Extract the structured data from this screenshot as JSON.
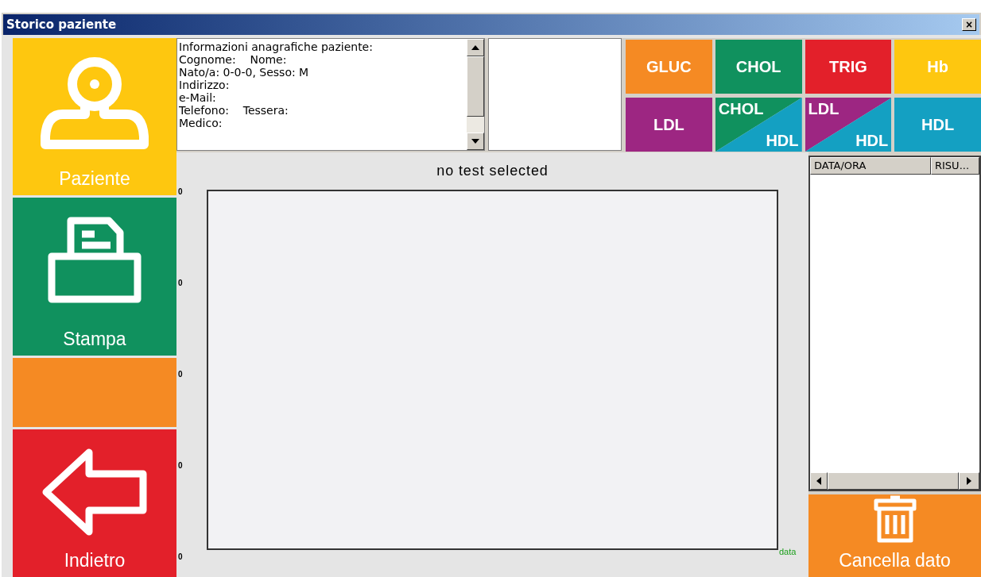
{
  "window": {
    "title": "Storico paziente",
    "close": "×"
  },
  "side_buttons": [
    {
      "kind": "patient",
      "label": "Paziente",
      "color": "#fec70f"
    },
    {
      "kind": "print",
      "label": "Stampa",
      "color": "#10915e"
    },
    {
      "kind": "blank",
      "color": "#f58a23"
    },
    {
      "kind": "back",
      "label": "Indietro",
      "color": "#e3202a"
    }
  ],
  "patient_info": [
    "Informazioni anagrafiche paziente:",
    "Cognome:    Nome:",
    "Nato/a: 0-0-0, Sesso: M",
    "Indirizzo:",
    "e-Mail:",
    "Telefono:    Tessera:",
    "Medico:"
  ],
  "tests": [
    {
      "kind": "single",
      "label": "GLUC",
      "color": "#f58a23"
    },
    {
      "kind": "single",
      "label": "CHOL",
      "color": "#10915e"
    },
    {
      "kind": "single",
      "label": "TRIG",
      "color": "#e3202a"
    },
    {
      "kind": "single",
      "label": "Hb",
      "color": "#fec70f"
    },
    {
      "kind": "single",
      "label": "LDL",
      "color": "#9d2682"
    },
    {
      "kind": "split",
      "parts": [
        {
          "label": "CHOL",
          "color": "#10915e"
        },
        {
          "label": "HDL",
          "color": "#14a0c2"
        }
      ]
    },
    {
      "kind": "split",
      "parts": [
        {
          "label": "LDL",
          "color": "#9d2682"
        },
        {
          "label": "HDL",
          "color": "#14a0c2"
        }
      ]
    },
    {
      "kind": "single",
      "label": "HDL",
      "color": "#14a0c2"
    }
  ],
  "chart": {
    "title": "no test selected",
    "y_labels": [
      "0",
      "0",
      "0",
      "0",
      "0"
    ],
    "x_label": "data"
  },
  "results_table": {
    "columns": [
      "DATA/ORA",
      "RISU..."
    ]
  },
  "delete_button": {
    "label": "Cancella dato"
  }
}
